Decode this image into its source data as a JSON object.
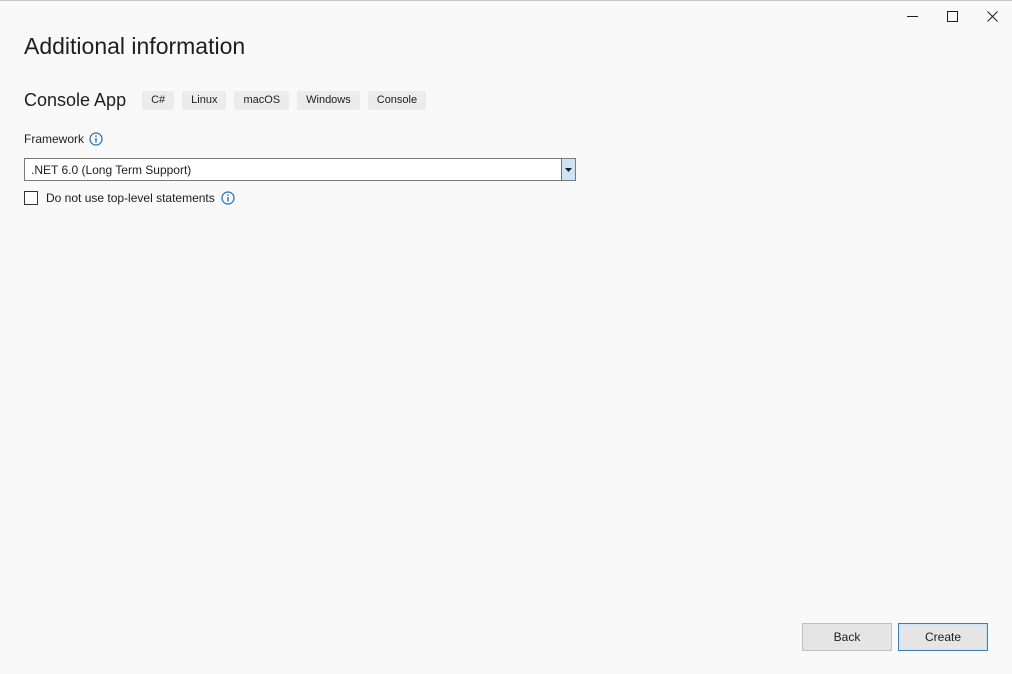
{
  "window": {
    "controls": {
      "minimize": "minimize-icon",
      "maximize": "maximize-icon",
      "close": "close-icon"
    }
  },
  "title": "Additional information",
  "template": {
    "name": "Console App",
    "tags": [
      "C#",
      "Linux",
      "macOS",
      "Windows",
      "Console"
    ]
  },
  "framework": {
    "label": "Framework",
    "info_icon": "info-icon",
    "selected": ".NET 6.0 (Long Term Support)"
  },
  "options": {
    "top_level_statements_label": "Do not use top-level statements",
    "top_level_statements_checked": false
  },
  "buttons": {
    "back": "Back",
    "create": "Create"
  },
  "colors": {
    "background": "#f9f9f9",
    "accent": "#3c7fb1",
    "info_icon": "#1a6fb3"
  }
}
